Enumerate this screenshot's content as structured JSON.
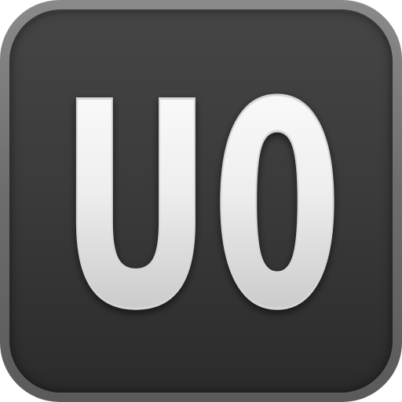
{
  "icon": {
    "monogram": "U0",
    "colors": {
      "bezel_light": "#8a8a8a",
      "bezel_dark": "#5a5a5a",
      "face_top": "#454545",
      "face_bottom": "#2b2b2b",
      "letter_highlight": "#ffffff",
      "letter_shade": "#b9b9b9"
    }
  }
}
